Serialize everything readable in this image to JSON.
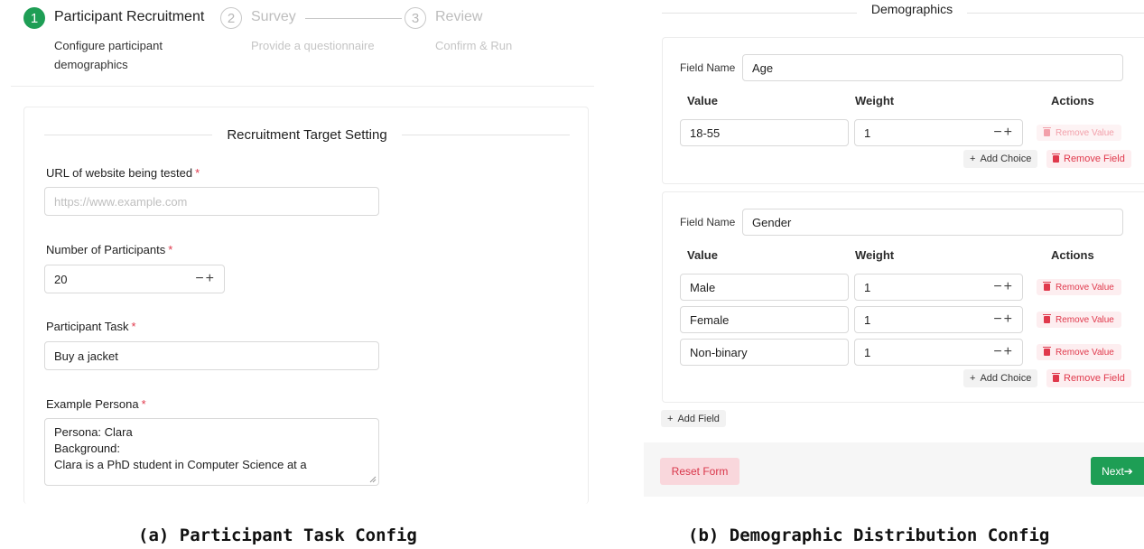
{
  "steps": [
    {
      "number": "1",
      "title": "Participant Recruitment",
      "desc_line1": "Configure participant",
      "desc_line2": "demographics"
    },
    {
      "number": "2",
      "title": "Survey",
      "desc": "Provide a questionnaire"
    },
    {
      "number": "3",
      "title": "Review",
      "desc": "Confirm & Run"
    }
  ],
  "recruitment": {
    "section_title": "Recruitment Target Setting",
    "url_label": "URL of website being tested",
    "url_placeholder": "https://www.example.com",
    "participants_label": "Number of Participants",
    "participants_value": "20",
    "task_label": "Participant Task",
    "task_value": "Buy a jacket",
    "persona_label": "Example Persona",
    "persona_lines": [
      "Persona: Clara",
      "Background:",
      "Clara is a PhD student in Computer Science at a"
    ],
    "required_mark": "*",
    "stepper": "−+"
  },
  "demographics": {
    "section_title": "Demographics",
    "field_name_label": "Field Name",
    "col_value": "Value",
    "col_weight": "Weight",
    "col_actions": "Actions",
    "remove_value_label": "Remove Value",
    "add_choice_label": "Add Choice",
    "remove_field_label": "Remove Field",
    "add_field_label": "Add Field",
    "plus": "+",
    "fields": [
      {
        "name": "Age",
        "values": [
          {
            "value": "18-55",
            "weight": "1"
          }
        ]
      },
      {
        "name": "Gender",
        "values": [
          {
            "value": "Male",
            "weight": "1"
          },
          {
            "value": "Female",
            "weight": "1"
          },
          {
            "value": "Non-binary",
            "weight": "1"
          }
        ]
      }
    ]
  },
  "footer": {
    "reset_label": "Reset Form",
    "next_label": "Next➔"
  },
  "captions": {
    "left": "(a) Participant Task Config",
    "right": "(b) Demographic Distribution Config"
  },
  "colors": {
    "primary": "#1e9e55",
    "danger": "#e0394c",
    "danger_bg": "#fdeef0",
    "reset_bg": "#f9d7dc"
  }
}
